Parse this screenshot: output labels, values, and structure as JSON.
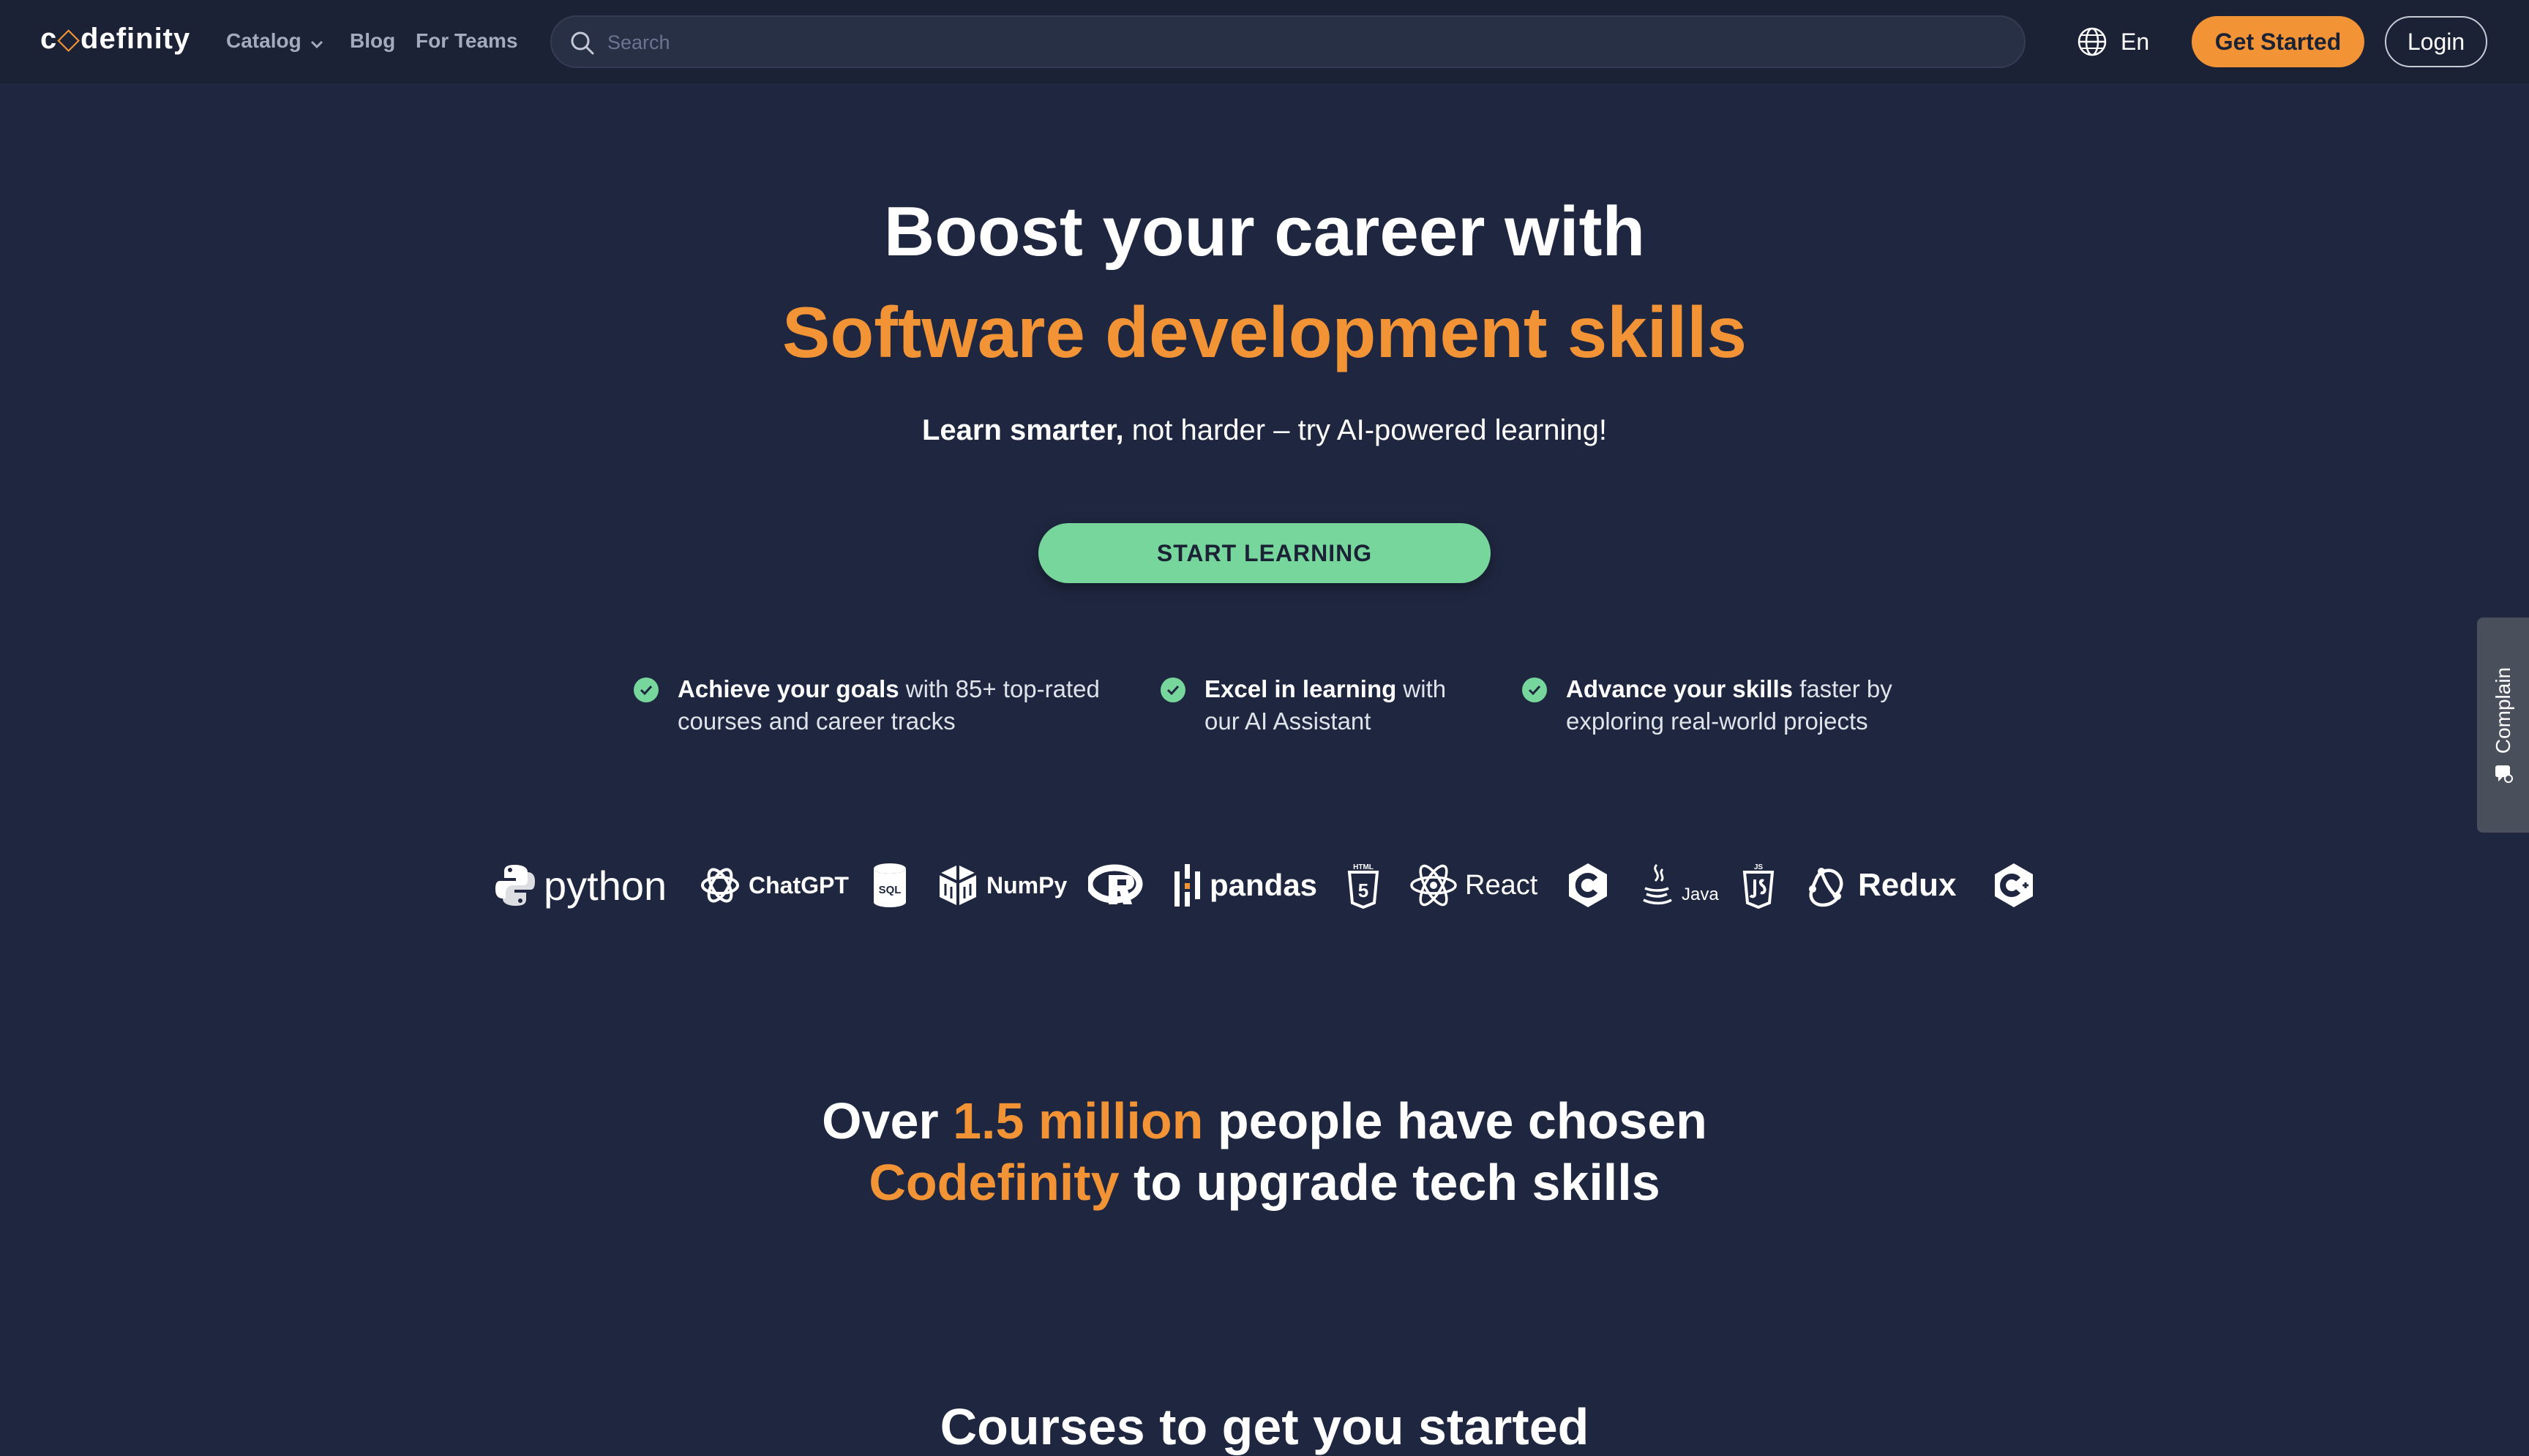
{
  "nav": {
    "logo": {
      "part1": "c",
      "part2": "definity"
    },
    "catalog": "Catalog",
    "blog": "Blog",
    "for_teams": "For Teams",
    "search_placeholder": "Search",
    "language": "En",
    "get_started": "Get Started",
    "login": "Login"
  },
  "hero": {
    "title_line1": "Boost your career with",
    "title_line2": "Software development skills",
    "subtitle_bold": "Learn smarter,",
    "subtitle_rest": " not harder – try AI-powered learning!",
    "cta": "START LEARNING",
    "features": [
      {
        "bold": "Achieve your goals",
        "rest": " with 85+ top-rated",
        "line2": "courses and career tracks"
      },
      {
        "bold": "Excel in learning",
        "rest": " with",
        "line2": "our AI Assistant"
      },
      {
        "bold": "Advance your skills",
        "rest": " faster by",
        "line2": "exploring real-world projects"
      }
    ]
  },
  "tech_logos": {
    "python": "python",
    "chatgpt": "ChatGPT",
    "sql": "SQL",
    "numpy": "NumPy",
    "pandas": "pandas",
    "html": "HTML",
    "react": "React",
    "java": "Java",
    "js": "JS",
    "redux": "Redux"
  },
  "stats": {
    "p1": "Over ",
    "hl1": "1.5 million",
    "p2": " people have chosen",
    "hl2": "Codefinity",
    "p3": " to upgrade tech skills"
  },
  "courses_heading": "Courses to get you started",
  "complain_tab": "Complain",
  "colors": {
    "accent": "#f29436",
    "green": "#76d69b",
    "background": "#1f2740",
    "nav": "#1b2235"
  }
}
